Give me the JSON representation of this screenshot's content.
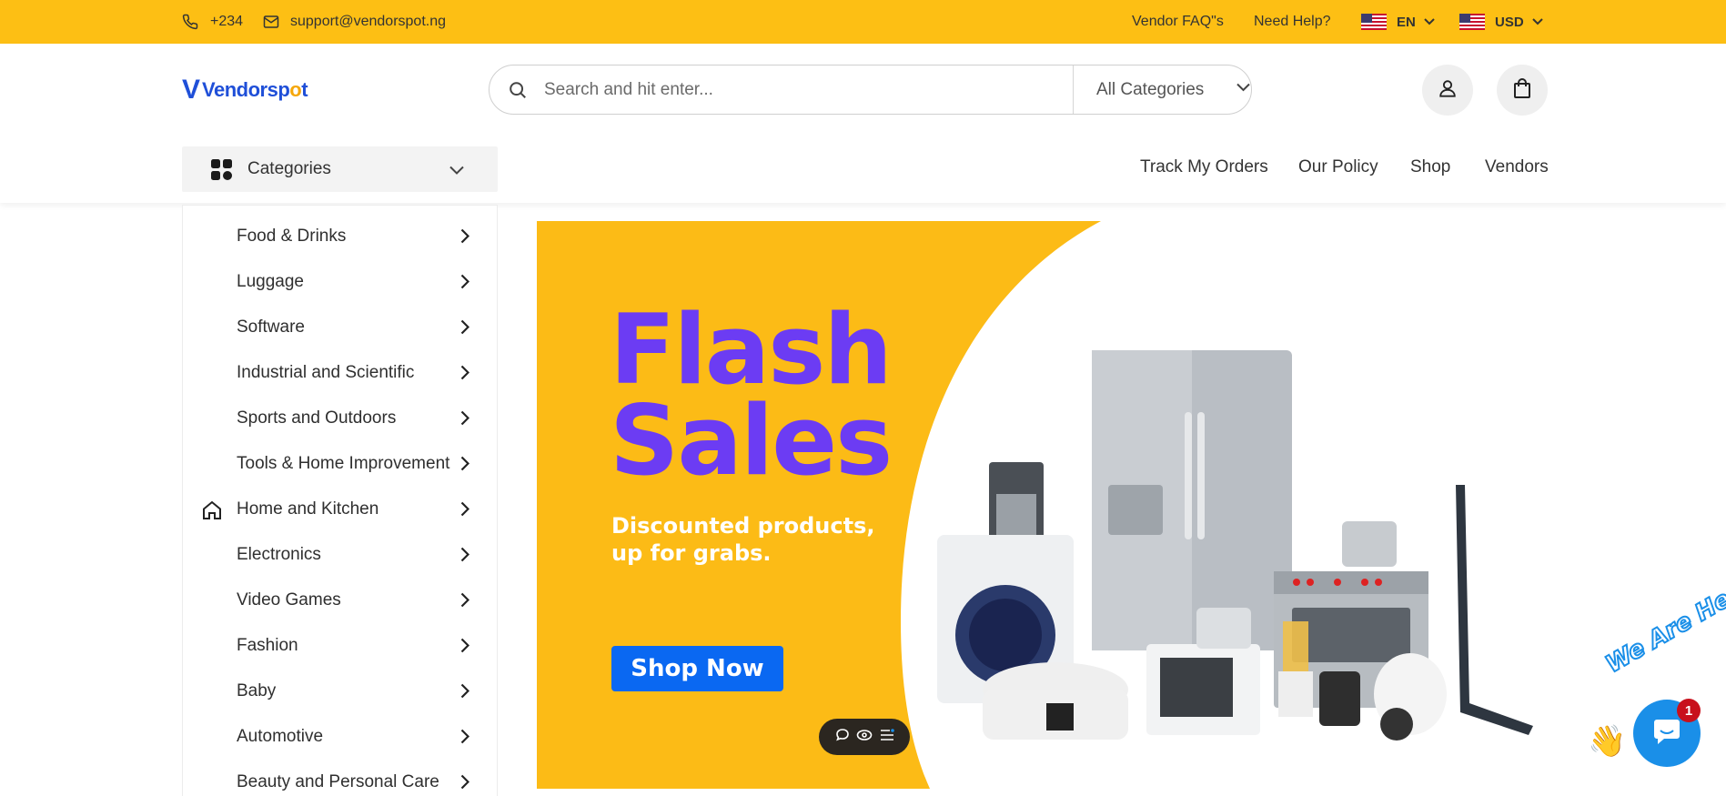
{
  "topbar": {
    "phone": "+234",
    "email": "support@vendorspot.ng",
    "vendor_faq": "Vendor FAQ\"s",
    "need_help": "Need Help?",
    "language": "EN",
    "currency": "USD"
  },
  "logo": {
    "v": "V",
    "name_a": "Vendorsp",
    "name_o": "o",
    "name_b": "t"
  },
  "search": {
    "placeholder": "Search and hit enter...",
    "category_select": "All Categories"
  },
  "categories_button": "Categories",
  "nav": {
    "track_orders": "Track My Orders",
    "policy": "Our Policy",
    "shop": "Shop",
    "vendors": "Vendors"
  },
  "sidebar": {
    "items": [
      {
        "label": "Food & Drinks"
      },
      {
        "label": "Luggage"
      },
      {
        "label": "Software"
      },
      {
        "label": "Industrial and Scientific"
      },
      {
        "label": "Sports and Outdoors"
      },
      {
        "label": "Tools & Home Improvement"
      },
      {
        "label": "Home and Kitchen",
        "icon": "home-icon"
      },
      {
        "label": "Electronics"
      },
      {
        "label": "Video Games"
      },
      {
        "label": "Fashion"
      },
      {
        "label": "Baby"
      },
      {
        "label": "Automotive"
      },
      {
        "label": "Beauty and Personal Care"
      }
    ]
  },
  "banner": {
    "title_line1": "Flash",
    "title_line2": "Sales",
    "subtitle_line1": "Discounted products,",
    "subtitle_line2": "up for grabs.",
    "cta": "Shop Now"
  },
  "chat_widget": {
    "tagline": "We Are Here!",
    "unread_count": "1"
  },
  "colors": {
    "accent_yellow": "#fdbf14",
    "brand_blue": "#1f4fd8",
    "flash_purple": "#6c3cf3",
    "cta_blue": "#0a68f2"
  }
}
